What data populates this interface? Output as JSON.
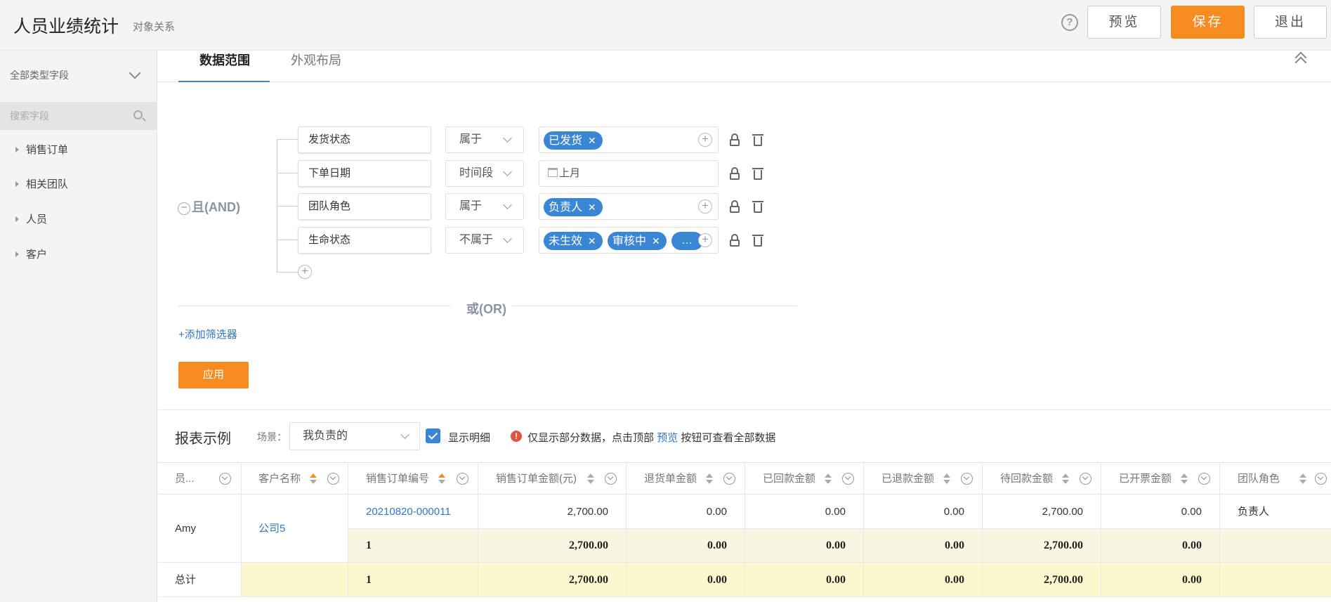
{
  "header": {
    "title": "人员业绩统计",
    "subtitle": "对象关系",
    "help": "?",
    "preview_label": "预览",
    "save_label": "保存",
    "exit_label": "退出"
  },
  "sidebar": {
    "field_type": "全部类型字段",
    "search_placeholder": "搜索字段",
    "items": [
      {
        "label": "销售订单"
      },
      {
        "label": "相关团队"
      },
      {
        "label": "人员"
      },
      {
        "label": "客户"
      }
    ]
  },
  "tabs": [
    {
      "label": "数据范围",
      "active": true
    },
    {
      "label": "外观布局",
      "active": false
    }
  ],
  "filters": {
    "and_label": "且(AND)",
    "minus": "−",
    "or_label": "或(OR)",
    "add_filter": "+添加筛选器",
    "apply_label": "应用",
    "plus": "+",
    "rows": [
      {
        "field": "发货状态",
        "operator": "属于",
        "tags": [
          "已发货"
        ]
      },
      {
        "field": "下单日期",
        "operator": "时间段",
        "date_value": "上月"
      },
      {
        "field": "团队角色",
        "operator": "属于",
        "tags": [
          "负责人"
        ]
      },
      {
        "field": "生命状态",
        "operator": "不属于",
        "tags": [
          "未生效",
          "审核中",
          "…"
        ]
      }
    ]
  },
  "report": {
    "title": "报表示例",
    "scene_label": "场景：",
    "scene_value": "我负责的",
    "show_detail_label": "显示明细",
    "show_detail_checked": true,
    "notice_prefix": "仅显示部分数据，点击顶部",
    "notice_link": "预览",
    "notice_suffix": "按钮可查看全部数据",
    "warn": "!"
  },
  "table": {
    "columns": [
      "员...",
      "客户名称",
      "销售订单编号",
      "销售订单金额(元)",
      "退货单金额",
      "已回款金额",
      "已退款金额",
      "待回款金额",
      "已开票金额",
      "团队角色"
    ],
    "row": {
      "person": "Amy",
      "customer": "公司5",
      "order_no": "20210820-000011",
      "order_amount": "2,700.00",
      "return_amount": "0.00",
      "received": "0.00",
      "refunded": "0.00",
      "pending": "2,700.00",
      "invoiced": "0.00",
      "role": "负责人"
    },
    "subtotal": {
      "count": "1",
      "order_amount": "2,700.00",
      "return_amount": "0.00",
      "received": "0.00",
      "refunded": "0.00",
      "pending": "2,700.00",
      "invoiced": "0.00"
    },
    "total": {
      "label": "总计",
      "count": "1",
      "order_amount": "2,700.00",
      "return_amount": "0.00",
      "received": "0.00",
      "refunded": "0.00",
      "pending": "2,700.00",
      "invoiced": "0.00"
    }
  },
  "colors": {
    "accent_orange": "#f68b1f",
    "accent_blue": "#3b86d4",
    "link_blue": "#2f78c4"
  }
}
